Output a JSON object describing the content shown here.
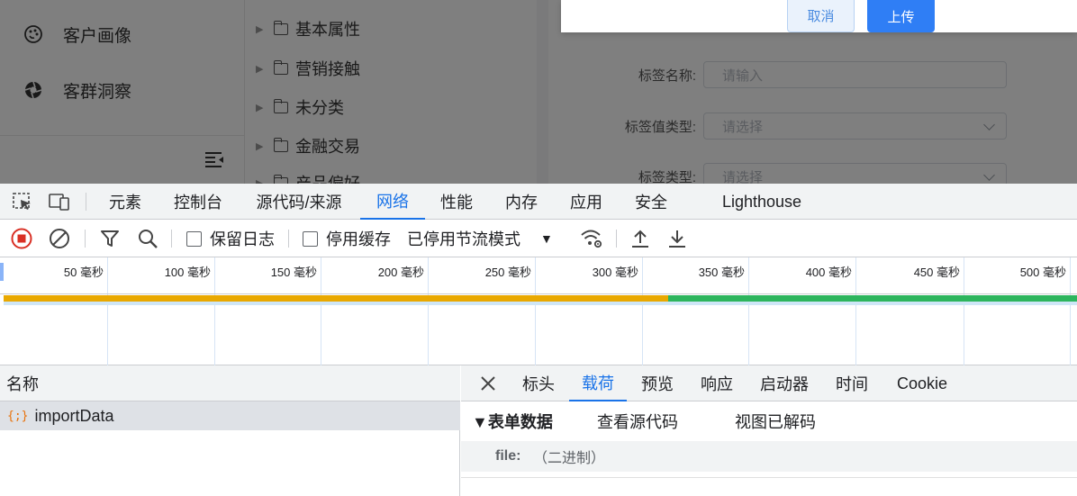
{
  "app": {
    "sidebar": {
      "items": [
        {
          "label": "客户画像",
          "icon": "palette-icon"
        },
        {
          "label": "客群洞察",
          "icon": "aperture-icon"
        }
      ],
      "collapse_icon": "menu-collapse-icon"
    },
    "tree": {
      "nodes": [
        "基本属性",
        "营销接触",
        "未分类",
        "金融交易",
        "产品偏好"
      ]
    },
    "form": {
      "fields": [
        {
          "label": "标签名称:",
          "placeholder": "请输入",
          "type": "input"
        },
        {
          "label": "标签值类型:",
          "placeholder": "请选择",
          "type": "select"
        },
        {
          "label": "标签类型:",
          "placeholder": "请选择",
          "type": "select"
        }
      ]
    },
    "dialog": {
      "cancel_label": "取消",
      "upload_label": "上传",
      "primary_color": "#2f7ef5"
    }
  },
  "devtools": {
    "panel_tabs": [
      "元素",
      "控制台",
      "源代码/来源",
      "网络",
      "性能",
      "内存",
      "应用",
      "安全",
      "Lighthouse"
    ],
    "active_panel": "网络",
    "toolbar": {
      "preserve_log": "保留日志",
      "disable_cache": "停用缓存",
      "throttling": "已停用节流模式"
    },
    "timeline": {
      "ticks": [
        "50 毫秒",
        "100 毫秒",
        "150 毫秒",
        "200 毫秒",
        "250 毫秒",
        "300 毫秒",
        "350 毫秒",
        "400 毫秒",
        "450 毫秒",
        "500 毫秒"
      ],
      "waiting_color": "#e9a800",
      "download_color": "#2db55d"
    },
    "requests": {
      "header": "名称",
      "rows": [
        {
          "name": "importData",
          "icon": "{;}"
        }
      ]
    },
    "detail": {
      "tabs": [
        "标头",
        "载荷",
        "预览",
        "响应",
        "启动器",
        "时间",
        "Cookie"
      ],
      "active_tab": "载荷",
      "section_title": "▼表单数据",
      "view_source": "查看源代码",
      "view_decoded": "视图已解码",
      "fields": [
        {
          "key": "file:",
          "value": "（二进制）"
        }
      ]
    }
  }
}
